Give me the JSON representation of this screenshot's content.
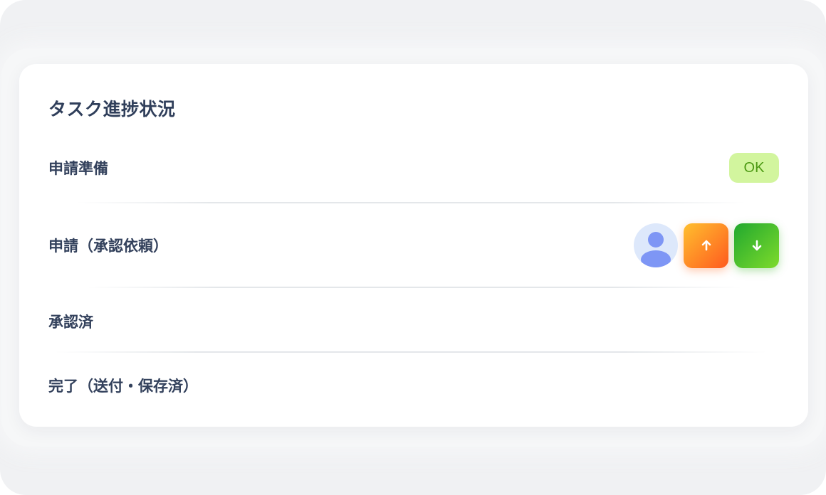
{
  "card": {
    "title": "タスク進捗状況"
  },
  "steps": [
    {
      "label": "申請準備",
      "badge": "OK"
    },
    {
      "label": "申請（承認依頼）"
    },
    {
      "label": "承認済"
    },
    {
      "label": "完了（送付・保存済）"
    }
  ],
  "icons": {
    "avatar": "user-avatar-icon",
    "up": "arrow-up-icon",
    "down": "arrow-down-icon"
  },
  "colors": {
    "ok_badge_bg": "#d2f59e",
    "ok_badge_text": "#4d9a14",
    "up_button": [
      "#ffbf2e",
      "#ff5a1f"
    ],
    "down_button": [
      "#21a82e",
      "#7edb2c"
    ],
    "avatar_bg": "#dde8fb",
    "avatar_fg": "#7e96f5"
  }
}
